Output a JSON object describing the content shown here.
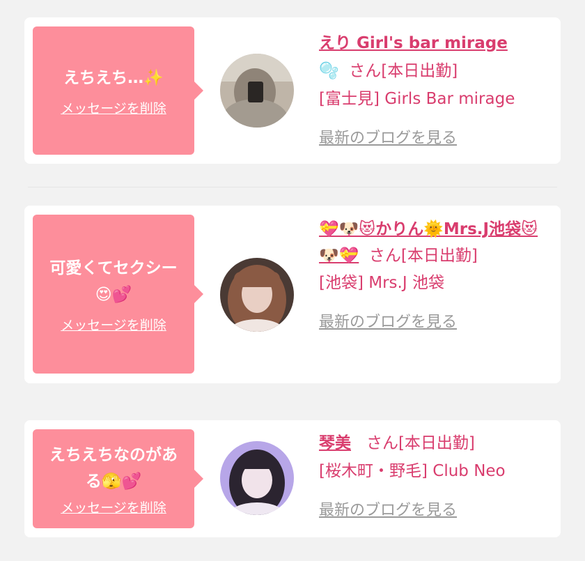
{
  "entries": [
    {
      "message": "えちえち…✨",
      "delete_label": "メッセージを削除",
      "name": "えり Girl's bar mirage",
      "name_icon": "🫧",
      "honorific": "さん",
      "status": "[本日出勤]",
      "shop": "[富士見] Girls Bar mirage",
      "blog_label": "最新のブログを見る",
      "avatar": "selfie-photo-beige"
    },
    {
      "message": "可愛くてセクシー😍💕",
      "delete_label": "メッセージを削除",
      "name": "💝🐶😻かりん🌞Mrs.J池袋😻🐶💝",
      "honorific": "さん",
      "status": "[本日出勤]",
      "shop": "[池袋] Mrs.J 池袋",
      "blog_label": "最新のブログを見る",
      "avatar": "portrait-photo-brown"
    },
    {
      "message": "えちえちなのがある🫣💕",
      "delete_label": "メッセージを削除",
      "name": "琴美",
      "honorific": "さん",
      "status": "[本日出勤]",
      "shop": "[桜木町・野毛] Club Neo",
      "blog_label": "最新のブログを見る",
      "avatar": "portrait-photo-purple"
    }
  ],
  "colors": {
    "bubble": "#fd8e9b",
    "accent": "#d93d6e",
    "muted": "#9a9a9a",
    "page_bg": "#f2f2f2"
  }
}
